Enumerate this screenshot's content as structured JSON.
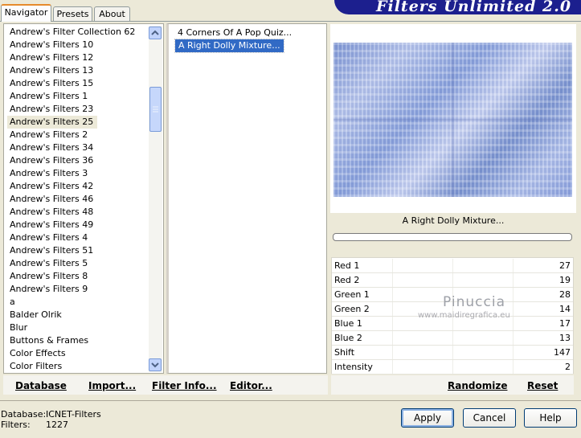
{
  "tabs": [
    {
      "label": "Navigator",
      "active": true
    },
    {
      "label": "Presets",
      "active": false
    },
    {
      "label": "About",
      "active": false
    }
  ],
  "banner": {
    "title": "Filters Unlimited 2.0"
  },
  "categories": [
    "Andrew's Filter Collection 62",
    "Andrew's Filters 10",
    "Andrew's Filters 12",
    "Andrew's Filters 13",
    "Andrew's Filters 15",
    "Andrew's Filters 1",
    "Andrew's Filters 23",
    "Andrew's Filters 25",
    "Andrew's Filters 2",
    "Andrew's Filters 34",
    "Andrew's Filters 36",
    "Andrew's Filters 3",
    "Andrew's Filters 42",
    "Andrew's Filters 46",
    "Andrew's Filters 48",
    "Andrew's Filters 49",
    "Andrew's Filters 4",
    "Andrew's Filters 51",
    "Andrew's Filters 5",
    "Andrew's Filters 8",
    "Andrew's Filters 9",
    "a",
    "Balder Olrik",
    "Blur",
    "Buttons & Frames",
    "Color Effects",
    "Color Filters"
  ],
  "selected_category": "Andrew's Filters 25",
  "filters": [
    {
      "label": "4 Corners Of A Pop Quiz...",
      "selected": false
    },
    {
      "label": "A Right Dolly Mixture...",
      "selected": true
    }
  ],
  "preview": {
    "filter_name": "A Right Dolly Mixture..."
  },
  "parameters": [
    {
      "label": "Red 1",
      "value": "27"
    },
    {
      "label": "Red 2",
      "value": "19"
    },
    {
      "label": "Green 1",
      "value": "28"
    },
    {
      "label": "Green 2",
      "value": "14"
    },
    {
      "label": "Blue 1",
      "value": "17"
    },
    {
      "label": "Blue 2",
      "value": "13"
    },
    {
      "label": "Shift",
      "value": "147"
    },
    {
      "label": "Intensity",
      "value": "2"
    }
  ],
  "watermark": {
    "name": "Pinuccia",
    "url": "www.maidiregrafica.eu"
  },
  "toolbar": {
    "database": "Database",
    "import": "Import...",
    "filter_info": "Filter Info...",
    "editor": "Editor...",
    "randomize": "Randomize",
    "reset": "Reset"
  },
  "status": {
    "database_label": "Database:",
    "database_value": "ICNET-Filters",
    "filters_label": "Filters:",
    "filters_value": "1227"
  },
  "buttons": {
    "apply": "Apply",
    "cancel": "Cancel",
    "help": "Help"
  },
  "colors": {
    "banner": "#1c1f8e",
    "selection": "#316ac5",
    "window": "#ece9d8"
  }
}
